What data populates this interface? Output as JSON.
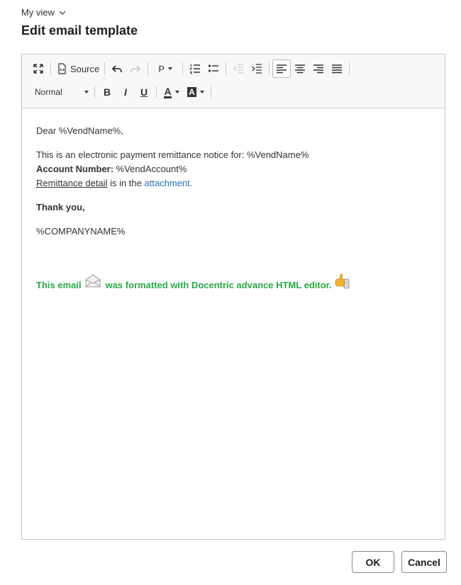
{
  "header": {
    "view_label": "My view",
    "page_title": "Edit email template"
  },
  "toolbar": {
    "maximize_icon": "maximize-icon",
    "source_label": "Source",
    "paragraph_label": "P",
    "format_value": "Normal",
    "bold_label": "B",
    "italic_label": "I",
    "underline_label": "U",
    "text_color_label": "A",
    "bg_color_label": "A"
  },
  "content": {
    "greeting": "Dear %VendName%,",
    "notice": "This is an electronic payment remittance notice for: %VendName%",
    "account_label": "Account Number:",
    "account_value": " %VendAccount%",
    "remittance_link": "Remittance detail",
    "remittance_mid": " is in the ",
    "attachment_link": "attachment.",
    "thanks": "Thank you,",
    "company": "%COMPANYNAME%",
    "footer_part1": "This email",
    "footer_part2": "was formatted with Docentric advance HTML editor.",
    "footer_color": "#28a745",
    "link_color": "#2a6ebb"
  },
  "actions": {
    "ok_label": "OK",
    "cancel_label": "Cancel"
  }
}
